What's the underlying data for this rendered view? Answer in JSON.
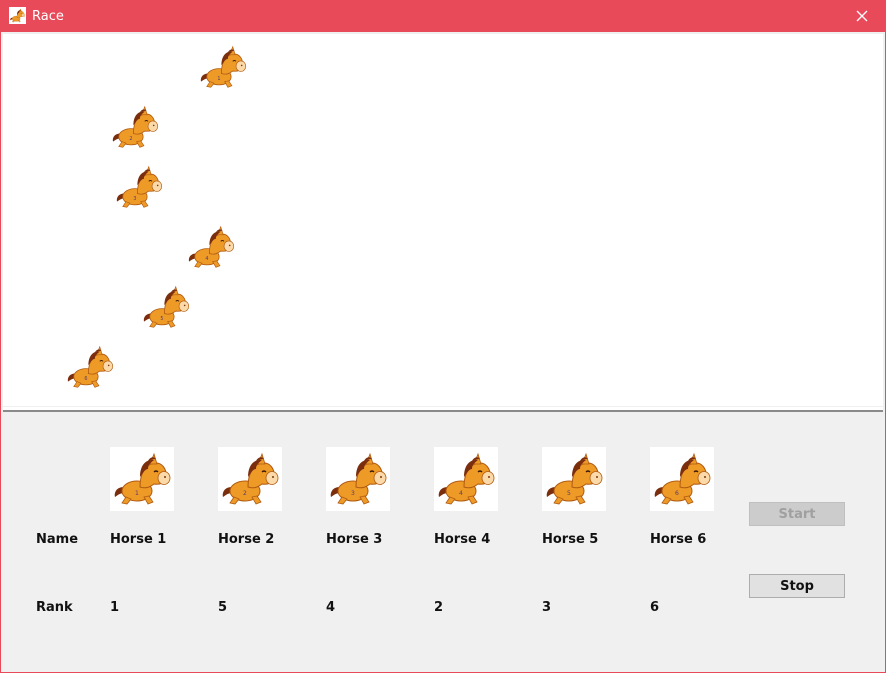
{
  "window": {
    "title": "Race",
    "accent_color": "#e84a5a",
    "app_icon": "horse-icon",
    "close_icon": "close-icon"
  },
  "race_track": {
    "horses": [
      {
        "number": "1"
      },
      {
        "number": "2"
      },
      {
        "number": "3"
      },
      {
        "number": "4"
      },
      {
        "number": "5"
      },
      {
        "number": "6"
      }
    ]
  },
  "panel": {
    "name_label": "Name",
    "rank_label": "Rank",
    "horses": [
      {
        "number": "1",
        "name": "Horse 1",
        "rank": "1"
      },
      {
        "number": "2",
        "name": "Horse 2",
        "rank": "5"
      },
      {
        "number": "3",
        "name": "Horse 3",
        "rank": "4"
      },
      {
        "number": "4",
        "name": "Horse 4",
        "rank": "2"
      },
      {
        "number": "5",
        "name": "Horse 5",
        "rank": "3"
      },
      {
        "number": "6",
        "name": "Horse 6",
        "rank": "6"
      }
    ],
    "start_button": {
      "label": "Start",
      "enabled": false
    },
    "stop_button": {
      "label": "Stop",
      "enabled": true
    }
  }
}
